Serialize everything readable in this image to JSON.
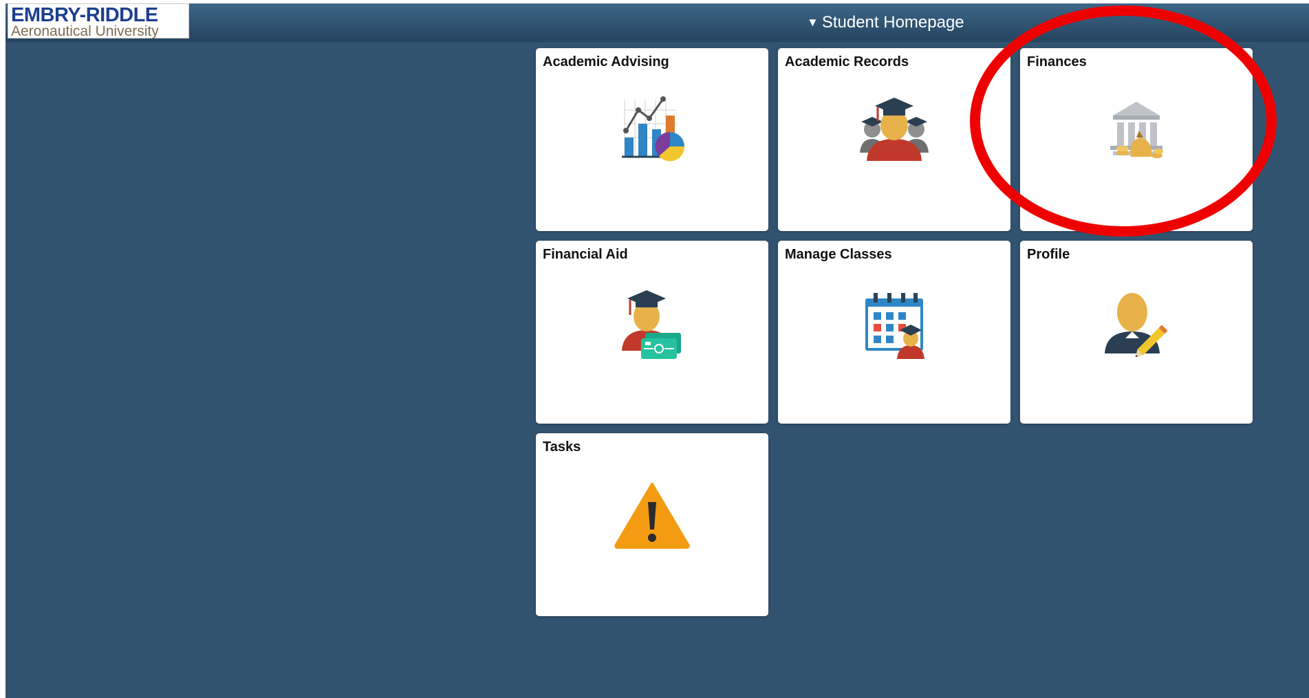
{
  "banner": {
    "logo": {
      "line1": "EMBRY-RIDDLE",
      "line2": "Aeronautical University"
    },
    "homepage_selector": {
      "label": "Student Homepage",
      "icon": "caret-down-icon"
    }
  },
  "tiles": [
    {
      "title": "Academic Advising",
      "icon": "academic-advising-icon"
    },
    {
      "title": "Academic Records",
      "icon": "academic-records-icon"
    },
    {
      "title": "Finances",
      "icon": "finances-icon"
    },
    {
      "title": "Financial Aid",
      "icon": "financial-aid-icon"
    },
    {
      "title": "Manage Classes",
      "icon": "manage-classes-icon"
    },
    {
      "title": "Profile",
      "icon": "profile-icon"
    },
    {
      "title": "Tasks",
      "icon": "tasks-icon"
    }
  ],
  "annotation": {
    "highlight": "red-ellipse around Finances tile"
  },
  "colors": {
    "page_background": "#31536f",
    "banner": "#2d5071",
    "tile_background": "#ffffff",
    "highlight_ring": "#ef0000",
    "logo_blue": "#1d3f8f",
    "logo_tan": "#7d6b4e"
  }
}
